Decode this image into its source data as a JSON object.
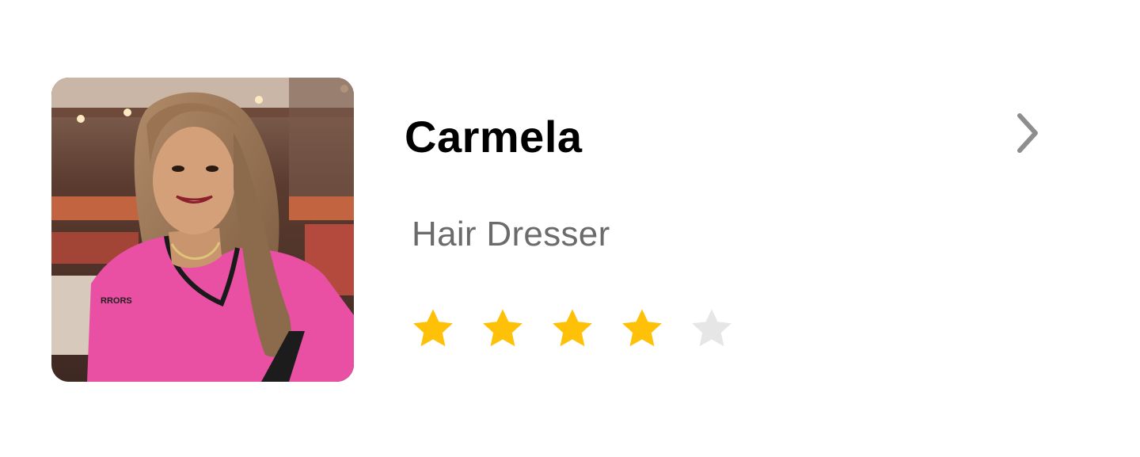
{
  "profile": {
    "name": "Carmela",
    "role": "Hair Dresser",
    "photo_alt": "Portrait of Carmela",
    "uniform_logo": "RRORS"
  },
  "rating": {
    "value": 4,
    "max": 5,
    "filled_color": "#FFC107",
    "empty_color": "#E6E6E6"
  },
  "icons": {
    "star": "star-icon",
    "chevron": "chevron-right-icon"
  },
  "colors": {
    "chevron": "#8E8E8E",
    "role_text": "#6B6B6B",
    "name_text": "#000000"
  }
}
